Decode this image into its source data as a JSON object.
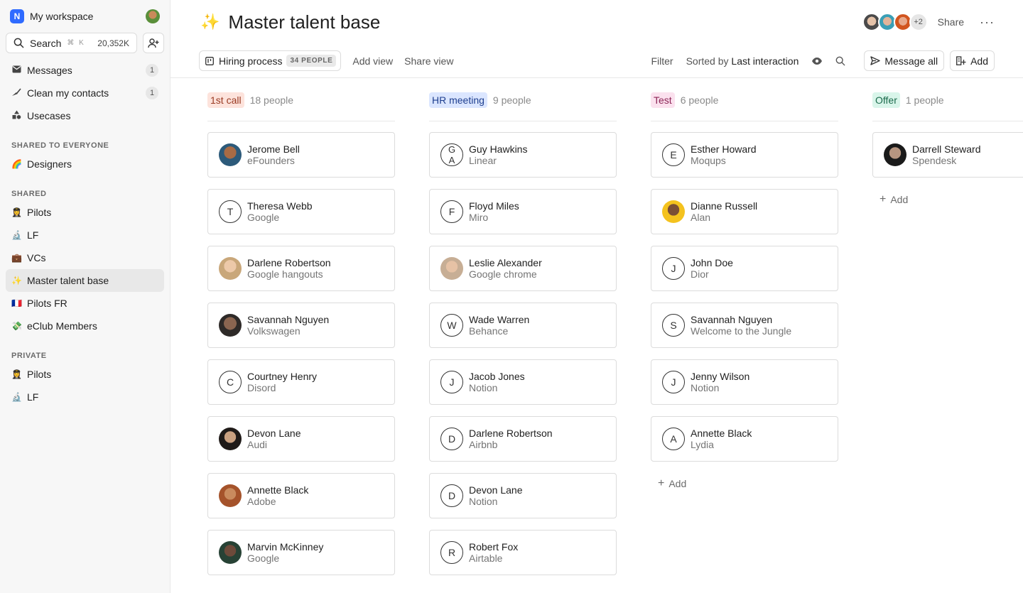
{
  "sidebar": {
    "workspace_logo": "N",
    "workspace_name": "My workspace",
    "search_label": "Search",
    "search_shortcut": "⌘ K",
    "search_count": "20,352K",
    "top_items": [
      {
        "label": "Messages",
        "badge": "1",
        "icon": "mail-icon"
      },
      {
        "label": "Clean my contacts",
        "badge": "1",
        "icon": "broom-icon"
      },
      {
        "label": "Usecases",
        "icon": "shapes-icon"
      }
    ],
    "section_shared_everyone": "SHARED TO EVERYONE",
    "shared_everyone_items": [
      {
        "label": "Designers",
        "emoji": "🌈"
      }
    ],
    "section_shared": "SHARED",
    "shared_items": [
      {
        "label": "Pilots",
        "emoji": "👩‍✈️"
      },
      {
        "label": "LF",
        "emoji": "🔬"
      },
      {
        "label": "VCs",
        "emoji": "💼"
      },
      {
        "label": "Master talent base",
        "emoji": "✨"
      },
      {
        "label": "Pilots FR",
        "emoji": "🇫🇷"
      },
      {
        "label": "eClub Members",
        "emoji": "💸"
      }
    ],
    "section_private": "PRIVATE",
    "private_items": [
      {
        "label": "Pilots",
        "emoji": "👩‍✈️"
      },
      {
        "label": "LF",
        "emoji": "🔬"
      }
    ]
  },
  "header": {
    "title_emoji": "✨",
    "title": "Master talent base",
    "more_avatars": "+2",
    "share_label": "Share",
    "more_label": "···"
  },
  "toolbar": {
    "view_label": "Hiring process",
    "view_count": "34 PEOPLE",
    "add_view": "Add view",
    "share_view": "Share view",
    "filter": "Filter",
    "sorted_prefix": "Sorted by",
    "sorted_value": "Last interaction",
    "message_all": "Message all",
    "add": "Add"
  },
  "columns": [
    {
      "stage": "1st call",
      "count": "18 people",
      "color": "#fde3dc",
      "text_color": "#9a3b23",
      "people": [
        {
          "name": "Jerome Bell",
          "company": "eFounders",
          "avatar": "photo"
        },
        {
          "name": "Theresa Webb",
          "company": "Google",
          "initial": "T"
        },
        {
          "name": "Darlene Robertson",
          "company": "Google hangouts",
          "avatar": "photo"
        },
        {
          "name": "Savannah Nguyen",
          "company": "Volkswagen",
          "avatar": "photo"
        },
        {
          "name": "Courtney Henry",
          "company": "Disord",
          "initial": "C"
        },
        {
          "name": "Devon Lane",
          "company": "Audi",
          "avatar": "photo"
        },
        {
          "name": "Annette Black",
          "company": "Adobe",
          "avatar": "photo"
        },
        {
          "name": "Marvin McKinney",
          "company": "Google",
          "avatar": "photo"
        }
      ]
    },
    {
      "stage": "HR meeting",
      "count": "9 people",
      "color": "#dbe6ff",
      "text_color": "#1f3f8f",
      "people": [
        {
          "name": "Guy Hawkins",
          "company": "Linear",
          "initial": "G A"
        },
        {
          "name": "Floyd Miles",
          "company": "Miro",
          "initial": "F"
        },
        {
          "name": "Leslie Alexander",
          "company": "Google chrome",
          "avatar": "photo"
        },
        {
          "name": "Wade Warren",
          "company": "Behance",
          "initial": "W"
        },
        {
          "name": "Jacob Jones",
          "company": "Notion",
          "initial": "J"
        },
        {
          "name": "Darlene Robertson",
          "company": "Airbnb",
          "initial": "D"
        },
        {
          "name": "Devon Lane",
          "company": "Notion",
          "initial": "D"
        },
        {
          "name": "Robert Fox",
          "company": "Airtable",
          "initial": "R"
        }
      ]
    },
    {
      "stage": "Test",
      "count": "6 people",
      "color": "#fbe1ee",
      "text_color": "#8c2456",
      "people": [
        {
          "name": "Esther Howard",
          "company": "Moqups",
          "initial": "E"
        },
        {
          "name": "Dianne Russell",
          "company": "Alan",
          "avatar": "photo"
        },
        {
          "name": "John Doe",
          "company": "Dior",
          "initial": "J"
        },
        {
          "name": "Savannah Nguyen",
          "company": "Welcome to the Jungle",
          "initial": "S"
        },
        {
          "name": "Jenny Wilson",
          "company": "Notion",
          "initial": "J"
        },
        {
          "name": "Annette Black",
          "company": "Lydia",
          "initial": "A"
        }
      ],
      "add_label": "Add"
    },
    {
      "stage": "Offer",
      "count": "1 people",
      "color": "#d9f5ea",
      "text_color": "#1b6b4c",
      "people": [
        {
          "name": "Darrell Steward",
          "company": "Spendesk",
          "avatar": "photo"
        }
      ],
      "add_label": "Add"
    }
  ]
}
